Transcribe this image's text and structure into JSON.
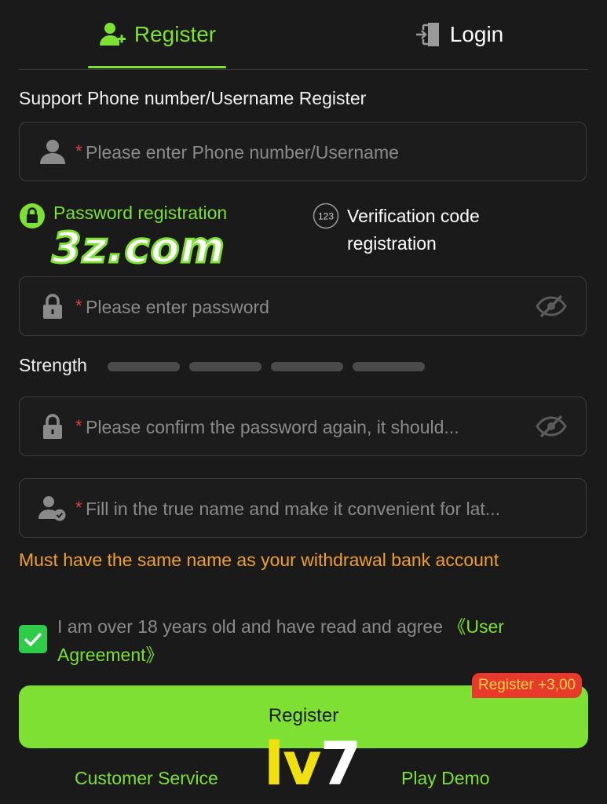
{
  "tabs": {
    "register": "Register",
    "login": "Login"
  },
  "form": {
    "section_label": "Support Phone number/Username Register",
    "required_mark": "*",
    "username_placeholder": "Please enter Phone number/Username",
    "password_placeholder": "Please enter password",
    "confirm_placeholder": "Please confirm the password again, it should...",
    "realname_placeholder": "Fill in the true name and make it convenient for lat..."
  },
  "modes": {
    "password": "Password registration",
    "code_line1": "Verification code",
    "code_line2": "registration",
    "code_icon_text": "123"
  },
  "watermark": "3z.com",
  "strength": {
    "label": "Strength",
    "level": 0,
    "segments": 4
  },
  "warning": "Must have the same name as your withdrawal bank account",
  "agreement": {
    "checked": true,
    "text": "I am over 18 years old and have read and agree ",
    "link": "《User Agreement》"
  },
  "register_button": "Register",
  "bonus_badge": "Register +3,00",
  "footer": {
    "customer_service": "Customer Service",
    "play_demo": "Play Demo"
  },
  "logo": {
    "part1": "lv",
    "part2": "7"
  },
  "colors": {
    "accent": "#7ee032",
    "warning": "#f0a030",
    "background": "#1a1a1a",
    "badge": "#e83a2a",
    "check": "#2fcc4a"
  }
}
